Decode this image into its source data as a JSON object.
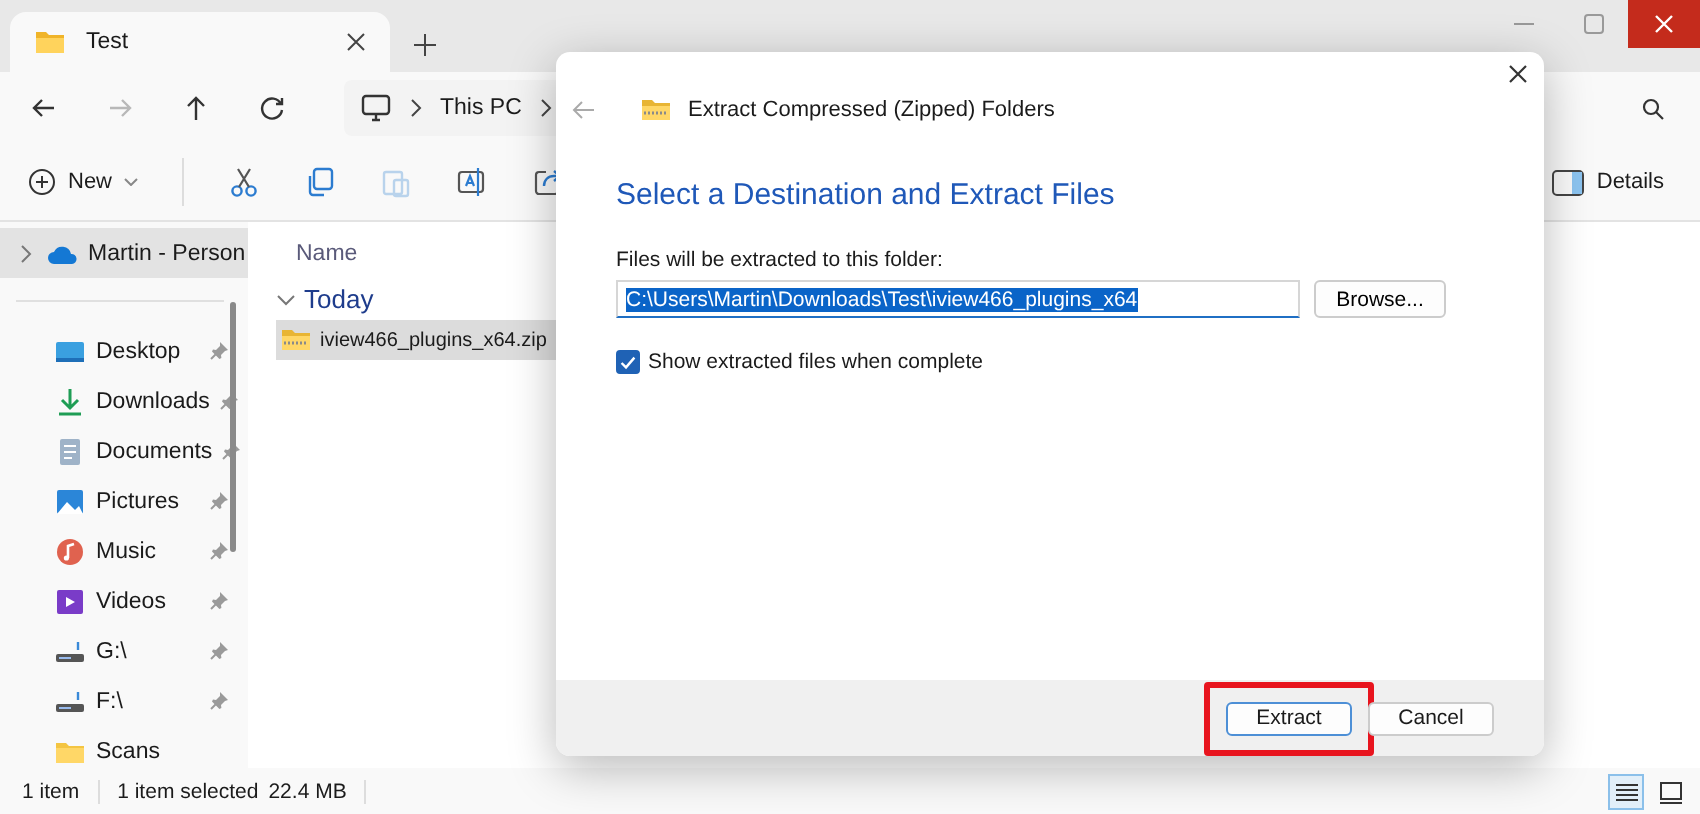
{
  "window": {
    "tab_title": "Test"
  },
  "navigation": [
    {
      "kind": "back",
      "disabled": false
    },
    {
      "kind": "forward",
      "disabled": true
    },
    {
      "kind": "up",
      "disabled": false
    },
    {
      "kind": "refresh",
      "disabled": false
    }
  ],
  "address_bar": {
    "segments": [
      "This PC"
    ]
  },
  "command_bar": {
    "new_label": "New",
    "actions": [
      {
        "kind": "cut",
        "disabled": false
      },
      {
        "kind": "copy",
        "disabled": false
      },
      {
        "kind": "paste",
        "disabled": true
      },
      {
        "kind": "rename",
        "disabled": false
      },
      {
        "kind": "share",
        "disabled": false
      }
    ],
    "details_label": "Details"
  },
  "sidebar": {
    "items": [
      {
        "label": "Martin - Person",
        "kind": "cloud",
        "selected": true,
        "expandable": true,
        "pinned": false
      },
      {
        "label": "Desktop",
        "kind": "desktop",
        "selected": false,
        "expandable": false,
        "pinned": true
      },
      {
        "label": "Downloads",
        "kind": "downloads",
        "selected": false,
        "expandable": false,
        "pinned": true
      },
      {
        "label": "Documents",
        "kind": "documents",
        "selected": false,
        "expandable": false,
        "pinned": true
      },
      {
        "label": "Pictures",
        "kind": "pictures",
        "selected": false,
        "expandable": false,
        "pinned": true
      },
      {
        "label": "Music",
        "kind": "music",
        "selected": false,
        "expandable": false,
        "pinned": true
      },
      {
        "label": "Videos",
        "kind": "videos",
        "selected": false,
        "expandable": false,
        "pinned": true
      },
      {
        "label": "G:\\",
        "kind": "drive",
        "selected": false,
        "expandable": false,
        "pinned": true
      },
      {
        "label": "F:\\",
        "kind": "drive",
        "selected": false,
        "expandable": false,
        "pinned": true
      },
      {
        "label": "Scans",
        "kind": "folder",
        "selected": false,
        "expandable": false,
        "pinned": false
      }
    ]
  },
  "file_list": {
    "column": "Name",
    "groups": [
      {
        "label": "Today",
        "expanded": true,
        "files": [
          {
            "name": "iview466_plugins_x64.zip",
            "selected": true
          }
        ]
      }
    ]
  },
  "status_bar": {
    "item_count": "1 item",
    "selection": "1 item selected",
    "size": "22.4 MB",
    "views": [
      {
        "kind": "details",
        "selected": true
      },
      {
        "kind": "tiles",
        "selected": false
      }
    ]
  },
  "dialog": {
    "title": "Extract Compressed (Zipped) Folders",
    "heading": "Select a Destination and Extract Files",
    "field_label": "Files will be extracted to this folder:",
    "path": "C:\\Users\\Martin\\Downloads\\Test\\iview466_plugins_x64",
    "path_selected": true,
    "browse_label": "Browse...",
    "show_files": {
      "label": "Show extracted files when complete",
      "checked": true
    },
    "buttons": [
      {
        "label": "Extract",
        "focused": true,
        "highlighted": true
      },
      {
        "label": "Cancel",
        "focused": false,
        "highlighted": false
      }
    ]
  }
}
